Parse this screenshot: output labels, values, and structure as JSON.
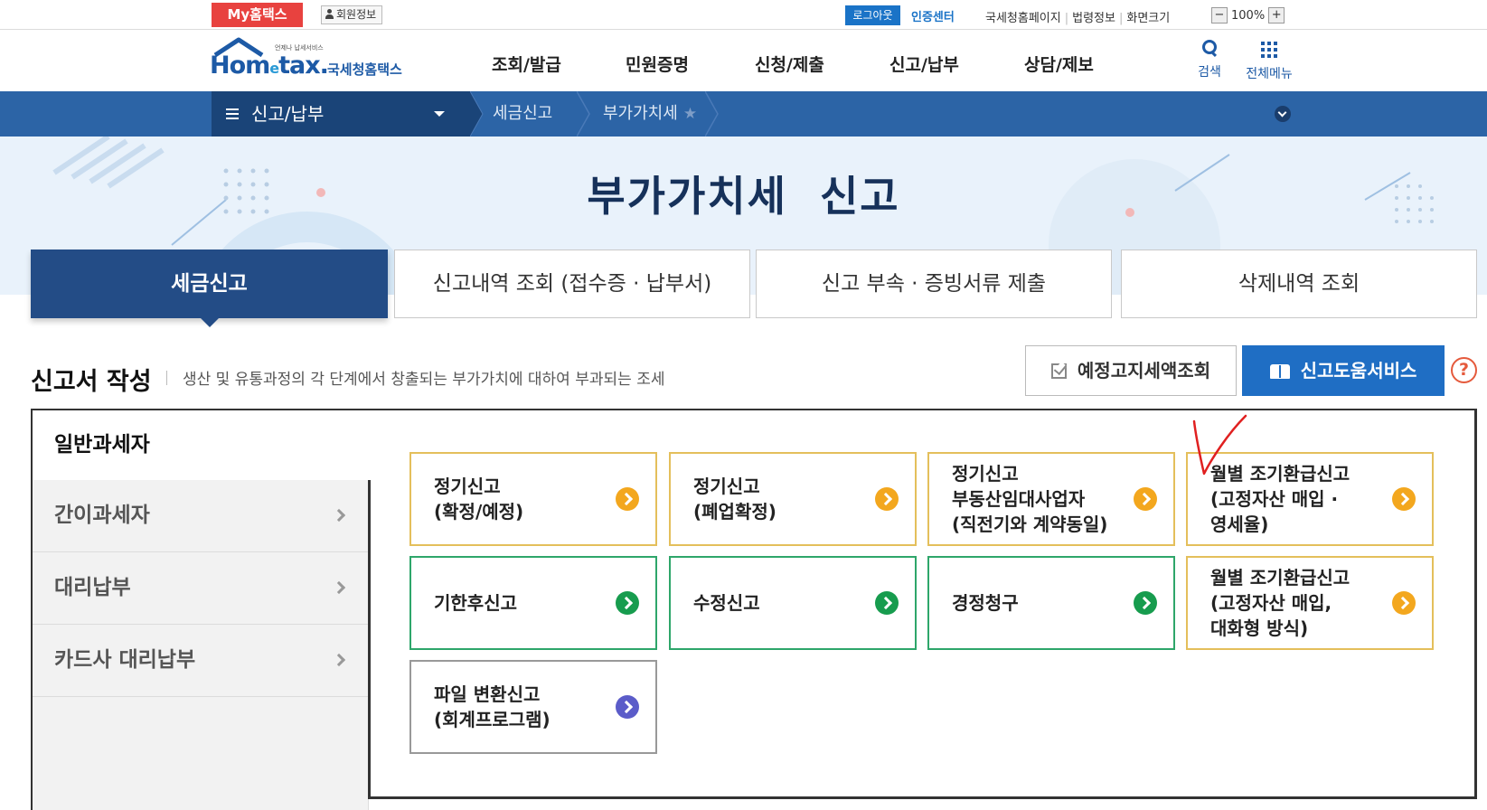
{
  "utility": {
    "my_hometax": "My홈택스",
    "member_info": "회원정보",
    "logout": "로그아웃",
    "cert_center": "인증센터",
    "links": [
      "국세청홈페이지",
      "법령정보",
      "화면크기"
    ],
    "zoom_minus": "−",
    "zoom_value": "100%",
    "zoom_plus": "+"
  },
  "header": {
    "logo_small": "언제나 납세서비스",
    "logo_main": "Hom",
    "logo_e": "e",
    "logo_tax": "tax.",
    "logo_kr": "국세청홈택스",
    "nav": [
      "조회/발급",
      "민원증명",
      "신청/제출",
      "신고/납부",
      "상담/제보"
    ],
    "search": "검색",
    "all_menu": "전체메뉴"
  },
  "breadcrumb": {
    "current": "신고/납부",
    "items": [
      "세금신고",
      "부가가치세"
    ]
  },
  "banner": {
    "title": "부가가치세  신고"
  },
  "tabs": [
    {
      "label": "세금신고",
      "active": true
    },
    {
      "label": "신고내역 조회 (접수증 · 납부서)",
      "active": false
    },
    {
      "label": "신고 부속 · 증빙서류 제출",
      "active": false
    },
    {
      "label": "삭제내역 조회",
      "active": false
    }
  ],
  "section": {
    "title": "신고서 작성",
    "description": "생산 및 유통과정의 각 단계에서 창출되는 부가가치에 대하여 부과되는 조세",
    "btn_preset": "예정고지세액조회",
    "btn_help": "신고도움서비스",
    "help_mark": "?"
  },
  "sidebar": {
    "active": "일반과세자",
    "items": [
      "간이과세자",
      "대리납부",
      "카드사 대리납부"
    ]
  },
  "cards": [
    {
      "label": "정기신고\n(확정/예정)",
      "color": "yellow"
    },
    {
      "label": "정기신고\n(폐업확정)",
      "color": "yellow"
    },
    {
      "label": "정기신고\n부동산임대사업자\n(직전기와 계약동일)",
      "color": "yellow"
    },
    {
      "label": "월별 조기환급신고\n(고정자산 매입 ·\n영세율)",
      "color": "yellow"
    },
    {
      "label": "기한후신고",
      "color": "green"
    },
    {
      "label": "수정신고",
      "color": "green"
    },
    {
      "label": "경정청구",
      "color": "green"
    },
    {
      "label": "월별 조기환급신고\n(고정자산 매입,\n대화형 방식)",
      "color": "yellow"
    },
    {
      "label": "파일 변환신고\n(회계프로그램)",
      "color": "purple"
    }
  ],
  "colors": {
    "brand_blue": "#1d5aa6",
    "crumb_bar": "#2c64a6",
    "active_tab": "#234c86",
    "help_button": "#1f6ec4",
    "my_hometax_red": "#e8423f",
    "arrow_yellow": "#f3a71e",
    "arrow_green": "#179c4e",
    "arrow_purple": "#5b5cc9",
    "annotation_red": "#e02020"
  }
}
